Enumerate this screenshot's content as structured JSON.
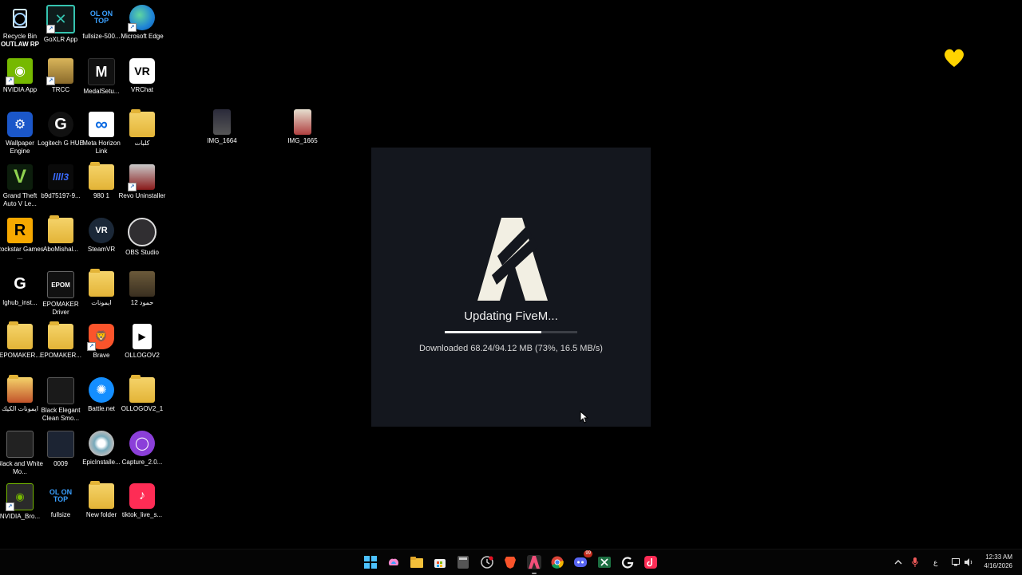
{
  "desktop": {
    "icons": [
      {
        "label": "Recycle Bin",
        "overlay": "OUTLAW RP"
      },
      {
        "label": "GoXLR App"
      },
      {
        "label": "fullsize-500...",
        "glyph": "OL ON TOP"
      },
      {
        "label": "Microsoft Edge"
      },
      {
        "label": "NVIDIA App"
      },
      {
        "label": "TRCC"
      },
      {
        "label": "MedalSetu...",
        "glyph": "M"
      },
      {
        "label": "VRChat",
        "glyph": "VR"
      },
      {
        "label": "Wallpaper Engine"
      },
      {
        "label": "Logitech G HUB",
        "glyph": "G"
      },
      {
        "label": "Meta Horizon Link",
        "glyph": "∞"
      },
      {
        "label": "كلبات"
      },
      {
        "label": "IMG_1664"
      },
      {
        "label": "IMG_1665"
      },
      {
        "label": "Grand Theft Auto V Le...",
        "glyph": "V"
      },
      {
        "label": "b9d75197-9...",
        "glyph": "llll3"
      },
      {
        "label": "980 1"
      },
      {
        "label": "Revo Uninstaller"
      },
      {
        "label": "Rockstar Games ...",
        "glyph": "R"
      },
      {
        "label": "AboMishal..."
      },
      {
        "label": "SteamVR",
        "glyph": "VR"
      },
      {
        "label": "OBS Studio"
      },
      {
        "label": "lghub_inst...",
        "glyph": "G"
      },
      {
        "label": "EPOMAKER Driver",
        "glyph": "EPOM"
      },
      {
        "label": "ايمونات"
      },
      {
        "label": "حمود 12"
      },
      {
        "label": "EPOMAKER..."
      },
      {
        "label": "EPOMAKER..."
      },
      {
        "label": "Brave"
      },
      {
        "label": "OLLOGOV2"
      },
      {
        "label": "ايمونات الكيك"
      },
      {
        "label": "Black Elegant Clean Smo..."
      },
      {
        "label": "Battle.net"
      },
      {
        "label": "OLLOGOV2_1"
      },
      {
        "label": "Black and White Mo..."
      },
      {
        "label": "0009"
      },
      {
        "label": "EpicInstalle..."
      },
      {
        "label": "Capture_2.0..."
      },
      {
        "label": "NVIDIA_Bro..."
      },
      {
        "label": "fullsize",
        "glyph": "OL ON TOP"
      },
      {
        "label": "New folder"
      },
      {
        "label": "tiktok_live_s..."
      }
    ]
  },
  "dialog": {
    "title": "Updating FiveM...",
    "progress": 0.73,
    "status": "Downloaded 68.24/94.12 MB (73%, 16.5 MB/s)"
  },
  "taskbar": {
    "apps": [
      "start-icon",
      "copilot-icon",
      "file-explorer-icon",
      "store-icon",
      "calculator-icon",
      "clock-app-icon",
      "brave-icon",
      "fivem-icon",
      "chrome-icon",
      "discord-icon",
      "excel-icon",
      "ghub-icon",
      "tiktok-icon"
    ],
    "discord_badge": "99",
    "tray_lang": "ع",
    "time": "12:33 AM",
    "date": "4/16/2026"
  },
  "colors": {
    "dialog_bg": "#14171e",
    "progress_fill": "#f0f0f0",
    "progress_track": "#3c3f46",
    "heart": "#ffd400"
  }
}
